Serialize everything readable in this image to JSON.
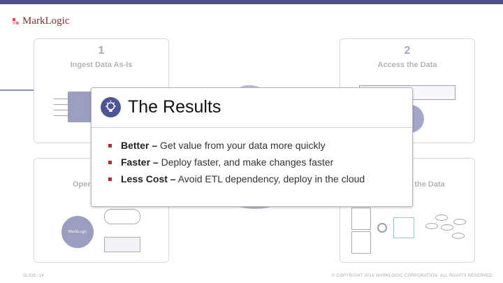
{
  "brand": {
    "logo_text": "MarkLogic"
  },
  "steps": [
    {
      "number": "1",
      "title": "Ingest Data As-Is"
    },
    {
      "number": "2",
      "title": "Access the Data"
    },
    {
      "title_partial": "Oper"
    },
    {
      "title_partial": "arich the Data"
    }
  ],
  "panel_logo_text": "MarkLogic",
  "results": {
    "title": "The Results",
    "items": [
      {
        "bold": "Better –",
        "text": " Get value from your data more quickly"
      },
      {
        "bold": "Faster –",
        "text": " Deploy faster, and make changes faster"
      },
      {
        "bold": "Less Cost –",
        "text": " Avoid ETL dependency, deploy in the cloud"
      }
    ]
  },
  "footer": {
    "slide": "SLIDE: 14",
    "copyright": "© COPYRIGHT 2016 MARKLOGIC CORPORATION. ALL RIGHTS RESERVED."
  },
  "colors": {
    "accent": "#4b4f8c",
    "bullet": "#c0272d",
    "logo": "#e0464b"
  }
}
